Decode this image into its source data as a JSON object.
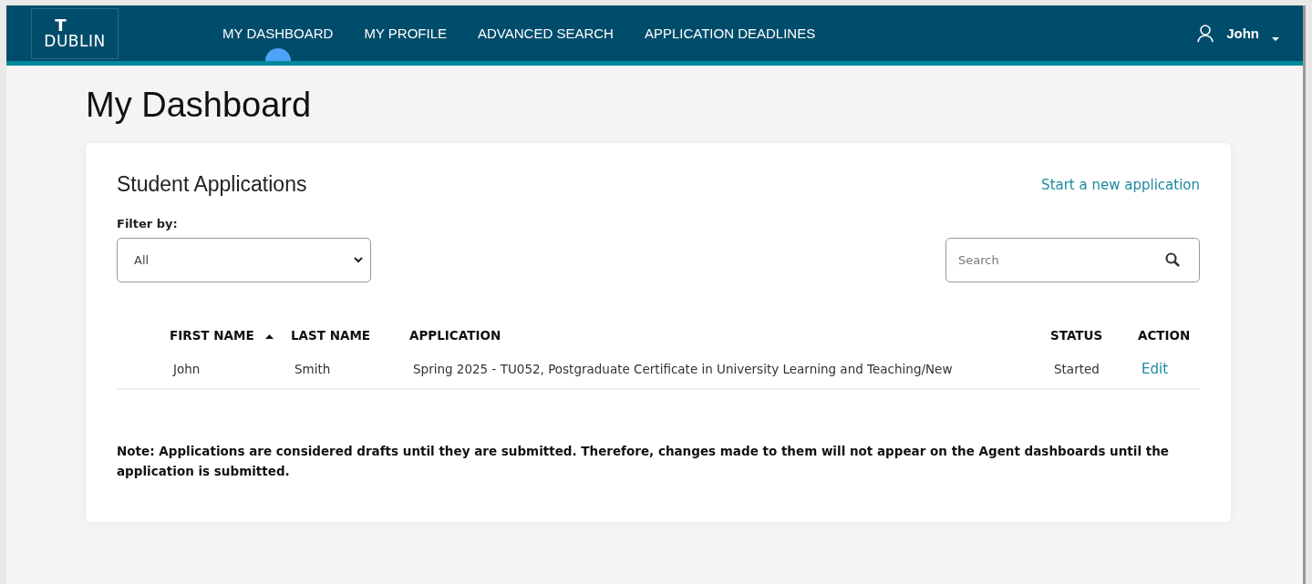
{
  "header": {
    "logo": {
      "mark": "T",
      "wordmark": "DUBLIN"
    },
    "nav": [
      {
        "label": "MY DASHBOARD",
        "selected": true
      },
      {
        "label": "MY PROFILE",
        "selected": false
      },
      {
        "label": "ADVANCED SEARCH",
        "selected": false
      },
      {
        "label": "APPLICATION DEADLINES",
        "selected": false
      }
    ],
    "user": {
      "name": "John"
    }
  },
  "page_title": "My Dashboard",
  "card": {
    "title": "Student Applications",
    "new_link": "Start a new application",
    "filter": {
      "label": "Filter by:",
      "value": "All"
    },
    "search": {
      "placeholder": "Search"
    },
    "table": {
      "columns": [
        {
          "label": "FIRST NAME",
          "sorted": true
        },
        {
          "label": "LAST NAME",
          "sorted": false
        },
        {
          "label": "APPLICATION",
          "sorted": false
        },
        {
          "label": "STATUS",
          "sorted": false
        },
        {
          "label": "ACTION",
          "sorted": false
        }
      ],
      "rows": [
        {
          "first_name": "John",
          "last_name": "Smith",
          "application": "Spring 2025 - TU052, Postgraduate Certificate in University Learning and Teaching/New",
          "status": "Started",
          "action": "Edit"
        }
      ]
    },
    "note": "Note: Applications are considered drafts until they are submitted. Therefore, changes made to them will not appear on the Agent dashboards until the application is submitted."
  }
}
